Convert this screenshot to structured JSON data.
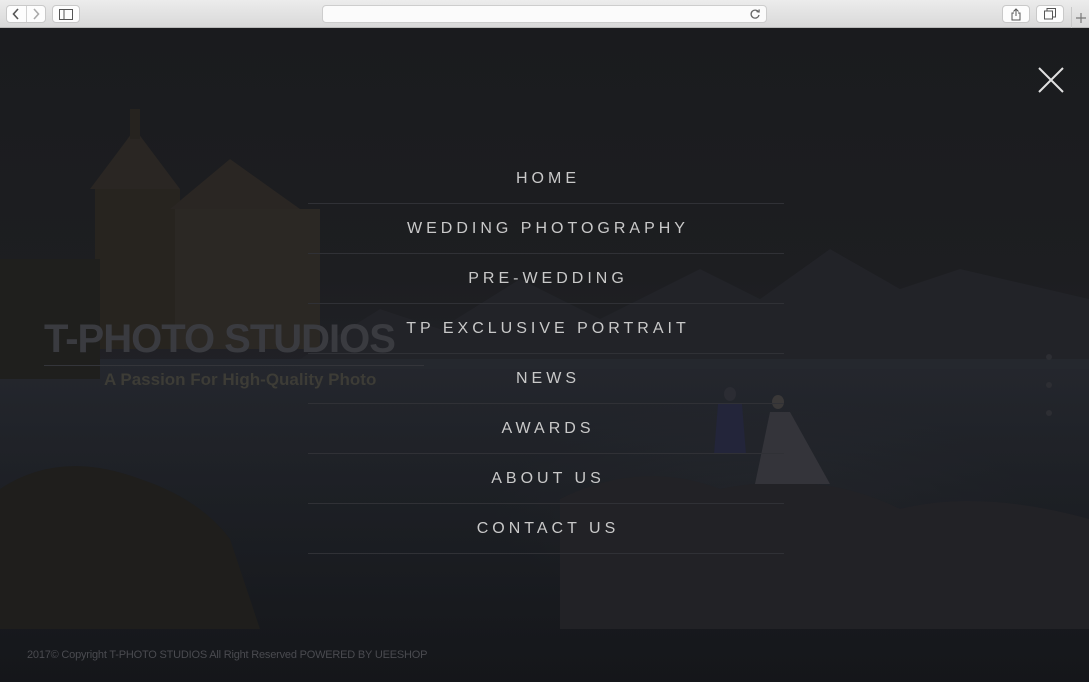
{
  "browser": {
    "back_icon": "chevron-left-icon",
    "forward_icon": "chevron-right-icon",
    "sidebar_icon": "sidebar-icon",
    "address_value": "",
    "reload_icon": "reload-icon",
    "share_icon": "share-icon",
    "tabs_icon": "tabs-icon",
    "new_tab_icon": "plus-icon"
  },
  "logo": {
    "text": "T-PHOTO STUDIOS",
    "tagline": "A Passion For High-Quality Photo"
  },
  "menu": {
    "items": [
      {
        "label": "HOME"
      },
      {
        "label": "WEDDING PHOTOGRAPHY"
      },
      {
        "label": "PRE-WEDDING"
      },
      {
        "label": "TP EXCLUSIVE PORTRAIT"
      },
      {
        "label": "NEWS"
      },
      {
        "label": "AWARDS"
      },
      {
        "label": "ABOUT US"
      },
      {
        "label": "CONTACT US"
      }
    ],
    "close_icon": "close-icon"
  },
  "footer": {
    "copyright": "2017© Copyright T-PHOTO STUDIOS All Right Reserved",
    "powered": "POWERED BY UEESHOP"
  },
  "colors": {
    "overlay": "#1b1c1e",
    "menu_text": "#c9c9c9",
    "divider": "#303136"
  }
}
